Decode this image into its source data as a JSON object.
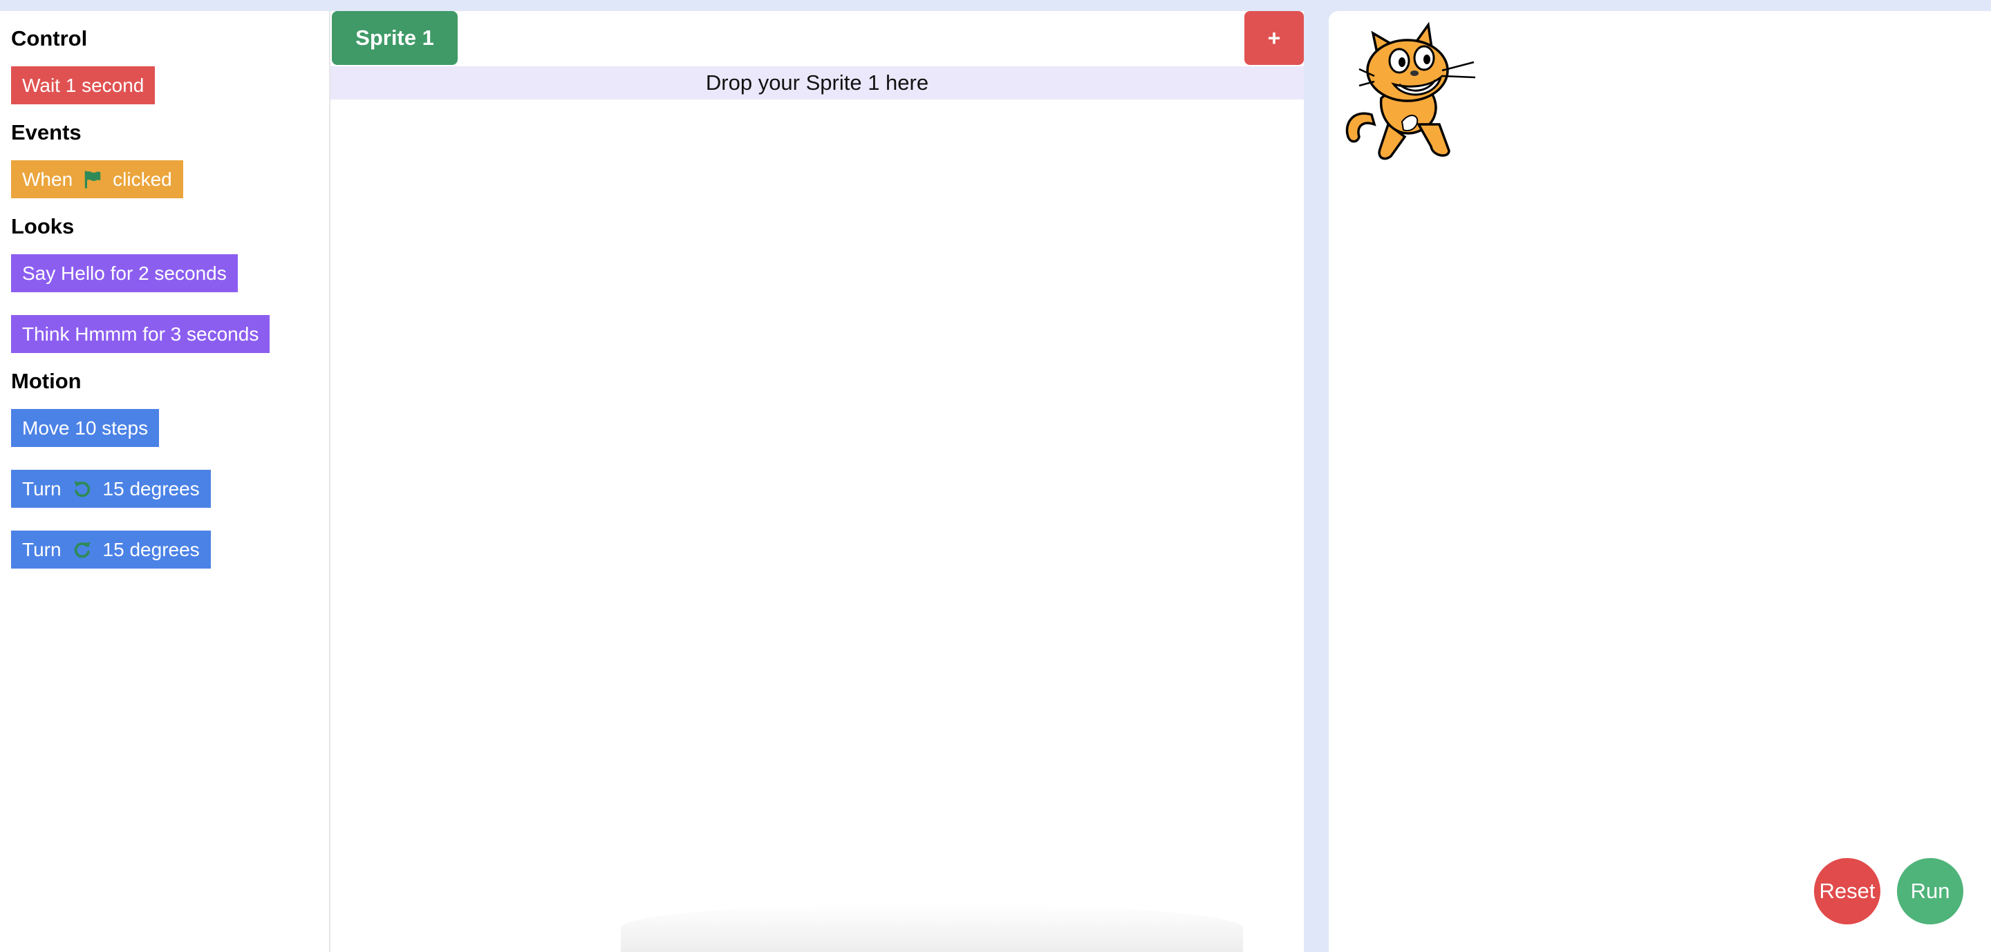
{
  "palette": {
    "categories": {
      "control": "Control",
      "events": "Events",
      "looks": "Looks",
      "motion": "Motion"
    },
    "blocks": {
      "wait": "Wait 1 second",
      "when_prefix": "When",
      "when_suffix": "clicked",
      "say": "Say Hello for 2 seconds",
      "think": "Think Hmmm for 3 seconds",
      "move": "Move 10 steps",
      "turn_left_prefix": "Turn",
      "turn_left_suffix": "15 degrees",
      "turn_right_prefix": "Turn",
      "turn_right_suffix": "15 degrees"
    },
    "icons": {
      "flag": "green-flag-icon",
      "turn_left": "rotate-counterclockwise-icon",
      "turn_right": "rotate-clockwise-icon"
    }
  },
  "editor": {
    "tabs": [
      {
        "label": "Sprite 1"
      }
    ],
    "add_tab_label": "+",
    "drop_zone_label": "Drop your Sprite 1 here"
  },
  "stage": {
    "sprite_name": "cat-sprite",
    "reset_label": "Reset",
    "run_label": "Run"
  },
  "colors": {
    "page_background": "#dfe7f8",
    "control": "#e05252",
    "events": "#eba53c",
    "looks": "#8c5ef0",
    "motion": "#4b82e6",
    "tab": "#3f9a67",
    "add_button": "#e05252",
    "reset": "#e14b4b",
    "run": "#4fb47a",
    "icon_green": "#2e8b57",
    "drop_zone": "#ebe8fb"
  }
}
